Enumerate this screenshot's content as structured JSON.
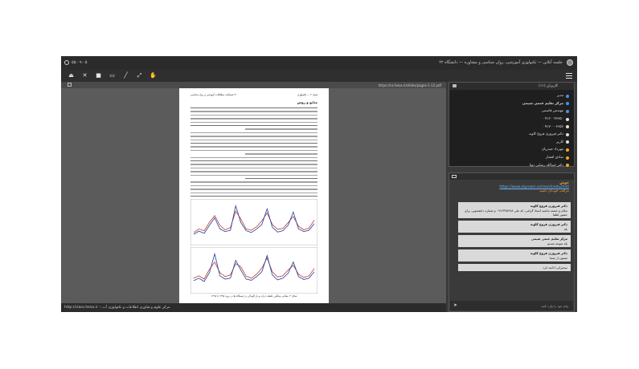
{
  "titlebar": {
    "clock": "۵۵:۰۹:۰۵",
    "title": "جلسه آنلاین — تکنولوژی آموزشی، روان شناسی و مشاوره — دانشگاه ۲۲"
  },
  "toolbar": {
    "tools": [
      "share-icon",
      "mic-off-icon",
      "camera-icon",
      "screen-icon",
      "pen-icon",
      "expand-icon",
      "hand-icon"
    ],
    "tool_glyphs": [
      "⏏",
      "✕",
      "■",
      "▭",
      "╱",
      "⤢",
      "✋"
    ]
  },
  "viewer": {
    "url": "https://ns.hesa.ir/slides/pages-1-12.pdf",
    "page": {
      "header_right": "فصل ۳ — تکنولوژی",
      "header_left": "۳۱ فصلنامه مطالعات آموزشی و روان شناسی",
      "section_title": "منابع و روش",
      "caption": "شکل ۴. مقادیر میانگین غلظت ذرات و بار آلودگی در ایستگاه ها در دوره ۱۳۹۵ تا ۱۳۹۸"
    }
  },
  "statusbar": {
    "left": "http://class.hesa.ir :: مرکز علوم و فناوری اطلاعات و تکنولوژی آب"
  },
  "users_panel": {
    "title": "کاربران (۱۱)",
    "users": [
      {
        "name": "مدیر",
        "color": "#4a90e2"
      },
      {
        "name": "مرکز تعلیم ختمی شیمی",
        "color": "#4a90e2"
      },
      {
        "name": "مهندس قاسمی",
        "color": "#4a90e2"
      },
      {
        "name": "۰۹۱۲۰۰۴۶۳۵۰",
        "color": "#e0e0e0"
      },
      {
        "name": "۰۹۱۷۰۰۰۳۶۵۶",
        "color": "#e0e0e0"
      },
      {
        "name": "دکتر فیروزی فروغ کاویه",
        "color": "#e0e0e0"
      },
      {
        "name": "کاربر",
        "color": "#e0e0e0"
      },
      {
        "name": "مهرداد حیدریان",
        "color": "#f5a623"
      },
      {
        "name": "صادق افشار",
        "color": "#f5a623"
      },
      {
        "name": "دکتر عبدالله رضایی دوتا",
        "color": "#f5a623"
      }
    ]
  },
  "chat": {
    "welcome_title": "خوش",
    "welcome_link": "https://www.skyroom.online/ch/edu2030",
    "welcome_note": "مراقب خودتان باشید",
    "messages": [
      {
        "name": "دکتر فیروزی فروغ کاویه",
        "text": "سلام و خسته نباشید استاد گرامی، کد ملی ۰۹۱۲۳۴۵۶۷۸ و شماره دانشجویی برای حضور لطفا"
      },
      {
        "name": "دکتر فیروزی فروغ کاویه",
        "text": "بله"
      },
      {
        "name": "مرکز تعلیم ختمی شیمی",
        "text": "بله متوجه شدیم"
      },
      {
        "name": "دکتر فیروزی فروغ کاویه",
        "text": "ممنون از شما"
      },
      {
        "name": "",
        "text": "سخنرانی ادامه دارد"
      }
    ],
    "input_placeholder": "پیام خود را وارد کنید"
  },
  "chart_data": [
    {
      "type": "line",
      "series": [
        {
          "values": [
            22,
            30,
            26,
            45,
            60,
            38,
            28,
            33,
            70,
            52,
            30,
            27,
            35,
            48,
            66,
            40,
            29,
            31,
            44,
            58,
            36,
            28,
            32,
            50
          ]
        },
        {
          "values": [
            18,
            25,
            20,
            38,
            55,
            30,
            24,
            27,
            82,
            44,
            26,
            22,
            30,
            40,
            75,
            34,
            23,
            26,
            38,
            68,
            30,
            24,
            27,
            42
          ]
        }
      ]
    },
    {
      "type": "line",
      "series": [
        {
          "values": [
            30,
            36,
            28,
            52,
            70,
            44,
            34,
            38,
            66,
            58,
            35,
            30,
            40,
            55,
            80,
            46,
            33,
            36,
            50,
            62,
            40,
            32,
            36,
            54
          ]
        },
        {
          "values": [
            24,
            30,
            22,
            44,
            90,
            36,
            28,
            30,
            74,
            50,
            28,
            25,
            34,
            46,
            86,
            38,
            26,
            30,
            42,
            70,
            34,
            27,
            30,
            46
          ]
        }
      ]
    }
  ]
}
